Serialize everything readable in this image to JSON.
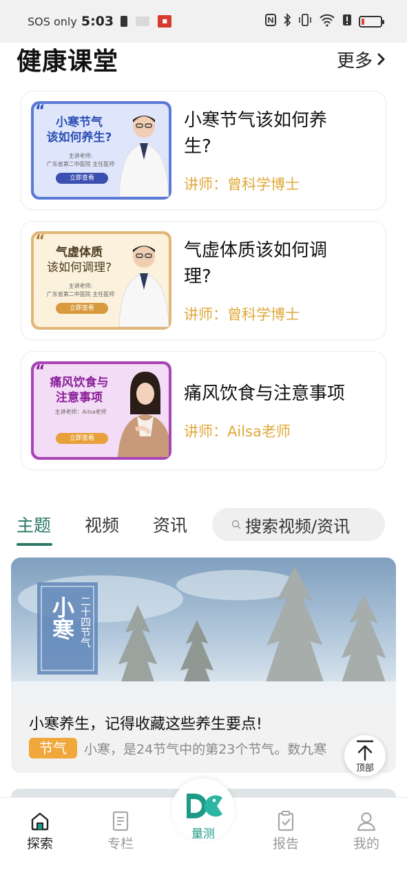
{
  "status_bar": {
    "carrier": "SOS only",
    "time": "5:03"
  },
  "section": {
    "title": "健康课堂",
    "more_label": "更多"
  },
  "courses": [
    {
      "title_line1": "小寒节气该如何养",
      "title_line2": "生?",
      "lecturer": "讲师：曾科学博士",
      "thumb_title_line1": "小寒节气",
      "thumb_title_line2": "该如何养生?",
      "thumb_teacher_label": "主讲老师:",
      "thumb_teacher": "广东省第二中医院 主任医师",
      "thumb_button": "立即查看",
      "thumb_color": "#5b79d6",
      "thumb_bg": "#dfe6fb",
      "thumb_text_color": "#2c4fb5"
    },
    {
      "title_line1": "气虚体质该如何调",
      "title_line2": "理?",
      "lecturer": "讲师：曾科学博士",
      "thumb_title_line1": "气虚体质",
      "thumb_title_line2": "该如何调理?",
      "thumb_teacher_label": "主讲老师:",
      "thumb_teacher": "广东省第二中医院 主任医师",
      "thumb_button": "立即查看",
      "thumb_color": "#e0b679",
      "thumb_bg": "#fbf1dc",
      "thumb_text_color": "#5a4422"
    },
    {
      "title_line1": "痛风饮食与注意事项",
      "title_line2": "",
      "lecturer": "讲师：Ailsa老师",
      "thumb_title_line1": "痛风饮食与",
      "thumb_title_line2": "注意事项",
      "thumb_teacher_label": "主讲老师：Ailsa老师",
      "thumb_teacher": "",
      "thumb_button": "立即查看",
      "thumb_color": "#a744b6",
      "thumb_bg": "#f3dcf5",
      "thumb_text_color": "#8a1f9a"
    }
  ],
  "tabs": [
    {
      "label": "主题",
      "active": true
    },
    {
      "label": "视频",
      "active": false
    },
    {
      "label": "资讯",
      "active": false
    }
  ],
  "search": {
    "placeholder": "搜索视频/资讯"
  },
  "feature": {
    "image_title_big": "小寒",
    "image_title_side": "二十四节气",
    "title": "小寒养生，记得收藏这些养生要点!",
    "tag": "节气",
    "description": "小寒，是24节气中的第23个节气。数九寒"
  },
  "back_to_top": {
    "label": "顶部"
  },
  "bottom_nav": [
    {
      "label": "探索",
      "icon": "home-icon",
      "active": true
    },
    {
      "label": "专栏",
      "icon": "document-icon",
      "active": false
    },
    {
      "label": "量测",
      "icon": "measure-logo-icon",
      "active": false
    },
    {
      "label": "报告",
      "icon": "clipboard-check-icon",
      "active": false
    },
    {
      "label": "我的",
      "icon": "user-icon",
      "active": false
    }
  ],
  "colors": {
    "accent": "#2c7766",
    "lecturer": "#e0a83a",
    "tag": "#f0a73b",
    "brand_teal": "#1e9b88"
  }
}
